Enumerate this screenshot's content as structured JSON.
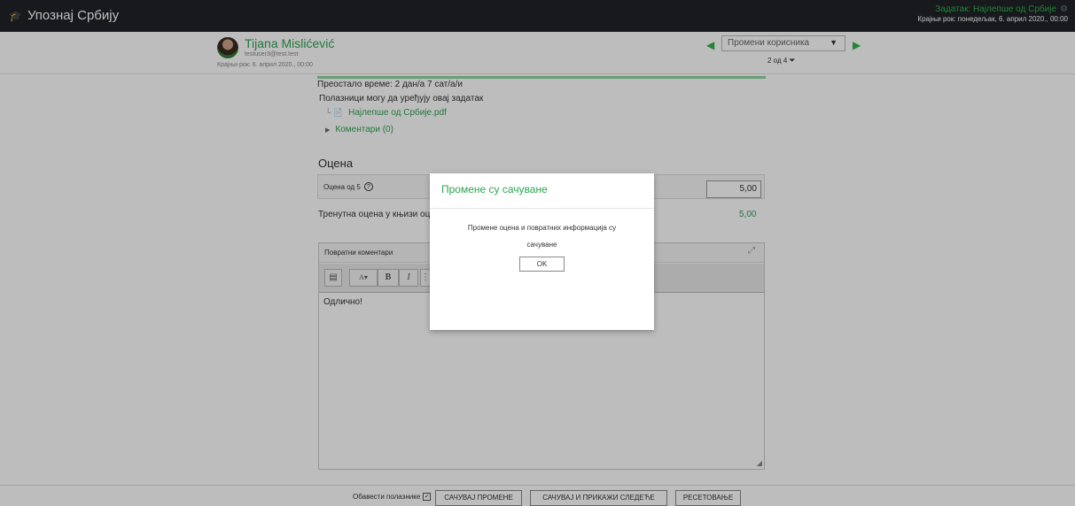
{
  "topbar": {
    "brand": "Упознај Србију",
    "cap_icon": "graduation-cap-icon",
    "assignment": "Задатак: Најлепше од Србије",
    "due": "Крајњи рок: понедељак, 6. април 2020., 00:00"
  },
  "header": {
    "user_name": "Tijana Mislićević",
    "user_email": "testuser3@test.test",
    "user_due": "Крајњи рок: 6. април 2020., 00:00",
    "change_user_placeholder": "Промени корисника",
    "counter": "2 од 4"
  },
  "content": {
    "time_remaining": "Преостало време: 2 дан/а 7 сат/а/и",
    "editable_note": "Полазници могу да уређују овај задатак",
    "file_name": "Најлепше од Србије.pdf",
    "comments_label": "Коментари (0)",
    "grade_title": "Оцена",
    "grade_label": "Оцена од 5",
    "grade_value": "5,00",
    "current_grade_label": "Тренутна оцена у књизи оцена",
    "current_grade_value": "5,00"
  },
  "feedback": {
    "title": "Повратни коментари",
    "text": "Одлично!"
  },
  "footer": {
    "notify_label": "Обавести полазнике",
    "save_label": "САЧУВАЈ ПРОМЕНЕ",
    "save_next_label": "САЧУВАЈ И ПРИКАЖИ СЛЕДЕЋЕ",
    "reset_label": "РЕСЕТОВАЊЕ"
  },
  "modal": {
    "title": "Промене су сачуване",
    "body": "Промене оцена и повратних информација су сачуване",
    "ok_label": "OK"
  },
  "colors": {
    "accent": "#2ea44f",
    "topbar": "#1f2326"
  }
}
